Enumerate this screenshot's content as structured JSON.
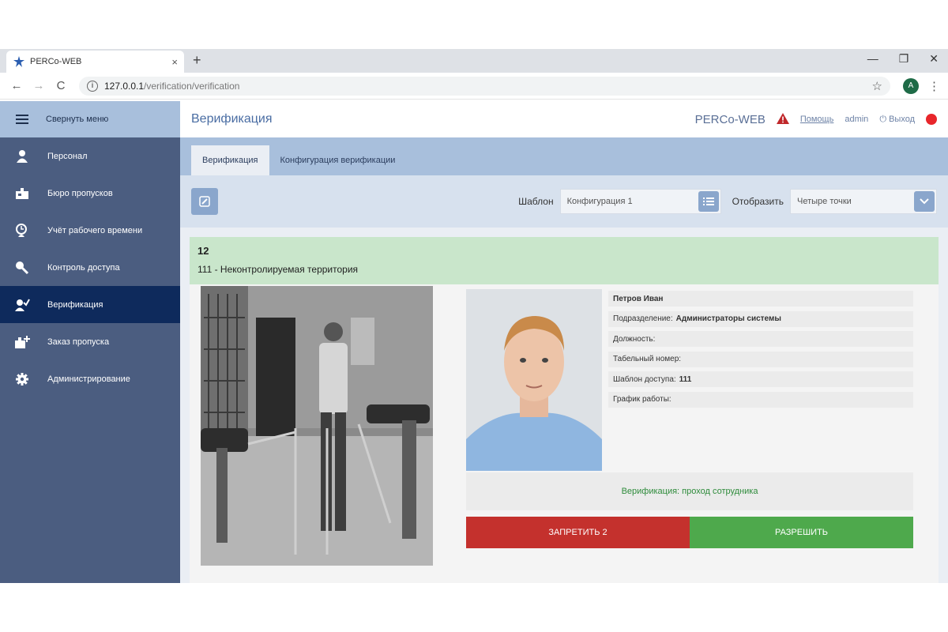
{
  "browser": {
    "tab_title": "PERCo-WEB",
    "tab_close": "×",
    "new_tab": "+",
    "url_host": "127.0.0.1",
    "url_path": "/verification/verification",
    "profile_initial": "A"
  },
  "sidebar": {
    "toggle_label": "Свернуть меню",
    "items": [
      {
        "label": "Персонал",
        "icon": "person-icon"
      },
      {
        "label": "Бюро пропусков",
        "icon": "pass-office-icon"
      },
      {
        "label": "Учёт рабочего времени",
        "icon": "time-tracking-icon"
      },
      {
        "label": "Контроль доступа",
        "icon": "access-key-icon"
      },
      {
        "label": "Верификация",
        "icon": "verification-icon",
        "active": true
      },
      {
        "label": "Заказ пропуска",
        "icon": "pass-order-icon"
      },
      {
        "label": "Администрирование",
        "icon": "gear-icon"
      }
    ]
  },
  "header": {
    "title": "Верификация",
    "brand": "PERCo-WEB",
    "help": "Помощь",
    "user": "admin",
    "logout": "Выход",
    "status_color": "#e8262b"
  },
  "tabs": [
    {
      "label": "Верификация",
      "active": true
    },
    {
      "label": "Конфигурация верификации",
      "active": false
    }
  ],
  "toolbar": {
    "template_label": "Шаблон",
    "template_value": "Конфигурация 1",
    "display_label": "Отобразить",
    "display_value": "Четыре точки"
  },
  "event": {
    "number": "12",
    "zone": "111 - Неконтролируемая территория"
  },
  "person": {
    "name": "Петров Иван",
    "department_label": "Подразделение:",
    "department_value": "Администраторы системы",
    "position_label": "Должность:",
    "tab_number_label": "Табельный номер:",
    "access_template_label": "Шаблон доступа:",
    "access_template_value": "111",
    "schedule_label": "График работы:"
  },
  "verification": {
    "message": "Верификация: проход сотрудника",
    "deny_label": "ЗАПРЕТИТЬ 2",
    "allow_label": "РАЗРЕШИТЬ"
  },
  "colors": {
    "sidebar": "#4b5d80",
    "sidebar_active": "#0e2a5c",
    "accent": "#a8bfdc",
    "deny": "#c4312d",
    "allow": "#4ea94c"
  }
}
